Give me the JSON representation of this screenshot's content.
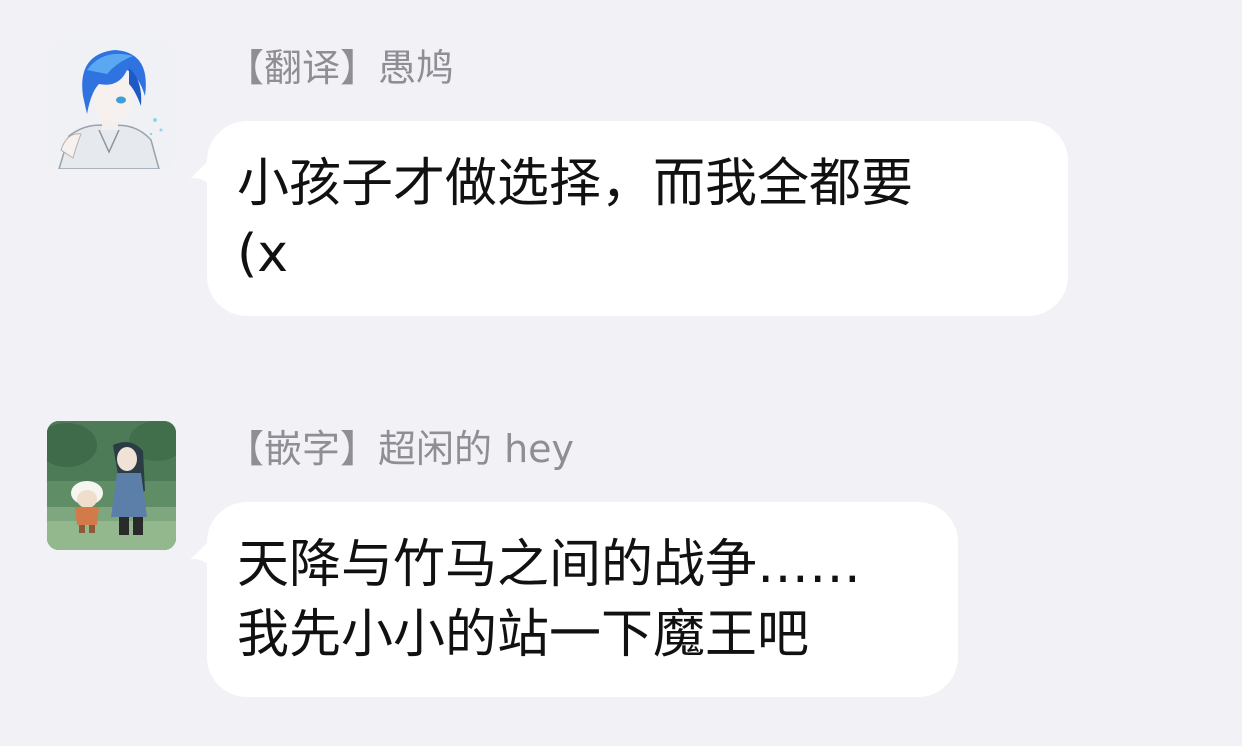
{
  "messages": [
    {
      "sender": "【翻译】愚鸠",
      "avatar_icon": "blue-haired-anime-boy-avatar",
      "text": "小孩子才做选择，而我全都要\n(x"
    },
    {
      "sender": "【嵌字】超闲的 hey",
      "avatar_icon": "forest-scene-anime-avatar",
      "text": "天降与竹马之间的战争……\n我先小小的站一下魔王吧"
    }
  ],
  "colors": {
    "background": "#f2f2f6",
    "bubble": "#ffffff",
    "sender_text": "#8e8e95",
    "message_text": "#111111"
  }
}
